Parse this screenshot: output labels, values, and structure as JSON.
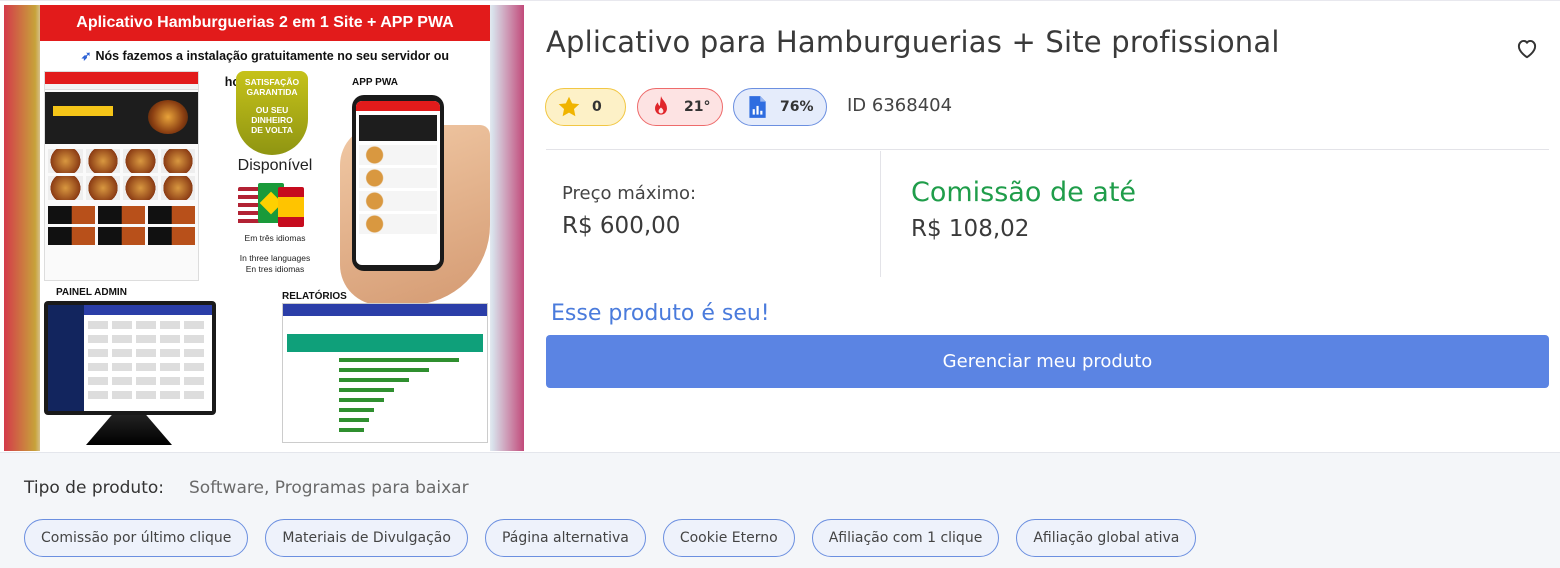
{
  "image": {
    "banner": "Aplicativo  Hamburguerias 2 em 1  Site + APP PWA",
    "subline": "Nós fazemos a instalação gratuitamente no seu servidor ou hospedagem.",
    "seal_lines": [
      "SATISFAÇÃO",
      "GARANTIDA",
      "OU SEU DINHEIRO",
      "DE VOLTA"
    ],
    "disponivel": "Disponível",
    "lang_pt": "Em três idiomas",
    "lang_en": "In three languages",
    "lang_es": "En tres idiomas",
    "app_label": "APP PWA",
    "painel_label": "PAINEL ADMIN",
    "relatorios_label": "RELATÓRIOS"
  },
  "product": {
    "title": "Aplicativo para Hamburguerias + Site profissional",
    "rating": "0",
    "temperature": "21°",
    "score": "76%",
    "id_text": "ID 6368404"
  },
  "pricing": {
    "max_price_label": "Preço máximo:",
    "max_price_value": "R$ 600,00",
    "commission_label": "Comissão de até",
    "commission_value": "R$ 108,02"
  },
  "owner": {
    "message": "Esse produto é seu!",
    "manage_button": "Gerenciar meu produto"
  },
  "footer": {
    "type_label": "Tipo de produto:",
    "type_value": "Software, Programas para baixar",
    "tags": [
      "Comissão por último clique",
      "Materiais de Divulgação",
      "Página alternativa",
      "Cookie Eterno",
      "Afiliação com 1 clique",
      "Afiliação global ativa"
    ]
  },
  "colors": {
    "accent_blue": "#5b84e3",
    "commission_green": "#1f9d4a",
    "owner_blue": "#4a7bdc",
    "banner_red": "#e21b1b"
  },
  "icons": [
    "heart-outline-icon",
    "star-icon",
    "fire-icon",
    "document-chart-icon",
    "rocket-icon"
  ]
}
